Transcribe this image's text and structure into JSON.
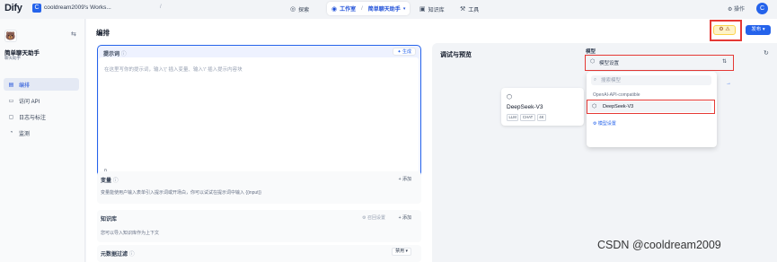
{
  "topbar": {
    "logo": "Dify",
    "workspace_icon": "C",
    "workspace_name": "cooldream2009's Works...",
    "separator": "/",
    "nav": {
      "explore": "探索",
      "studio": "工作室",
      "studio_separator": "/",
      "current_app": "简单聊天助手",
      "knowledge": "知识库",
      "tools": "工具"
    },
    "ops": "操作",
    "avatar_letter": "C"
  },
  "sidebar": {
    "app_icon": "🐻",
    "app_title": "简单聊天助手",
    "app_type": "聊天助手",
    "items": [
      {
        "label": "编排",
        "icon": "layout-icon",
        "active": true
      },
      {
        "label": "访问 API",
        "icon": "terminal-icon",
        "active": false
      },
      {
        "label": "日志与标注",
        "icon": "file-icon",
        "active": false
      },
      {
        "label": "监测",
        "icon": "chart-icon",
        "active": false
      }
    ]
  },
  "main": {
    "title": "编排",
    "prompt": {
      "label": "提示词",
      "generate": "生成",
      "placeholder": "在这里写你的提示词，输入'{' 插入变量、输入'/' 插入提示内容块",
      "count": "0"
    },
    "variables": {
      "title": "变量",
      "add": "添加",
      "desc": "变量能使用户输入表单引入提示词或开场白，你可以试试在提示词中输入 {{input}}"
    },
    "knowledge": {
      "title": "知识库",
      "recall": "召回设置",
      "add": "添加",
      "desc": "您可以导入知识库作为上下文"
    },
    "metadata": {
      "title": "元数据过滤",
      "select": "禁用"
    }
  },
  "actions": {
    "publish": "发布"
  },
  "debug": {
    "title": "调试与预览",
    "model_card": {
      "name": "DeepSeek-V3",
      "tags": [
        "LLM",
        "CHAT",
        "4K"
      ]
    }
  },
  "model_popup": {
    "label": "模型",
    "select_text": "模型设置",
    "search_placeholder": "搜索模型",
    "group": "OpenAI-API-compatible",
    "item": "DeepSeek-V3",
    "settings_link": "模型设置"
  },
  "watermark": "CSDN @cooldream2009",
  "colors": {
    "accent": "#2563eb",
    "highlight": "#e53935"
  }
}
